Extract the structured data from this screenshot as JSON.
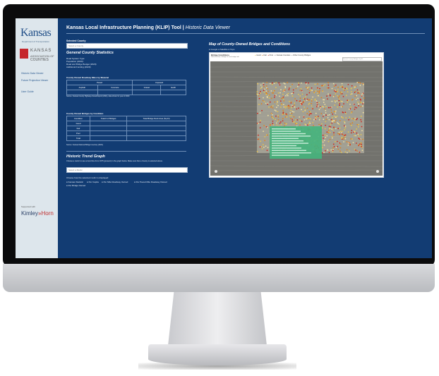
{
  "app": {
    "title": "Kansas Local Infrastructure Planning (KLIP) Tool |",
    "subtitle": "Historic Data Viewer"
  },
  "sidebar": {
    "logo_kansas": "Kansas",
    "logo_kdot": "Department of Transportation",
    "logo_counties_line1": "KANSAS",
    "logo_counties_line2": "ASSOCIATION OF",
    "logo_counties_line3": "COUNTIES",
    "links": [
      "Historic Data Viewer",
      "Future Projection Viewer",
      "User Guide"
    ],
    "supported_by": "Supported with",
    "partner_a": "Kimley",
    "partner_b": "»Horn"
  },
  "county": {
    "select_label": "Selected County",
    "select_placeholder": "Select a County",
    "stats_heading": "General County Statistics",
    "stats_lines": [
      "Road System Type:",
      "Population (2020):",
      "Road and Bridge Budget (2020):",
      "Additional Funding (2020):"
    ]
  },
  "roadway_table": {
    "title": "County Owned Roadway Miles by Material",
    "groups": [
      "Paved",
      "Unpaved"
    ],
    "columns": [
      "Asphalt",
      "Concrete",
      "Gravel",
      "Earth"
    ],
    "source": "Source: Kansas County Highway Annual Report (2021), data shown for year of 2020"
  },
  "bridge_table": {
    "title": "County Owned Bridges by Condition",
    "columns": [
      "Condition",
      "Total # of Bridges",
      "Total Bridge Deck Area (Sq Ft)"
    ],
    "rows": [
      "Good",
      "Fair",
      "Poor",
      "Total"
    ],
    "source": "Source: Kansas National Bridge Inventory (2021)"
  },
  "trend": {
    "heading": "Historic Trend Graph",
    "instructions": "Choose a metric to see a trend line from 1975 (present) in the graph below. Make sure that a County is selected above.",
    "select_placeholder": "Select a Metric",
    "choose_label": "Choose how the selected metric is displayed:",
    "options": [
      "Kansas Statistic",
      "Per Capita",
      "Per Mile Roadway Owned",
      "Per Paved Mile Roadway Owned",
      "Per Bridge Owned"
    ]
  },
  "map": {
    "title": "Map of County-Owned Bridges and Conditions",
    "basemap_options": [
      "Google",
      "Satellite",
      "Topo"
    ],
    "panel_title": "Bridge Conditions",
    "panel_sub": "Select (Click) a Bridge to view bridge info",
    "legend": [
      "Good",
      "Fair",
      "Poor",
      "Kansas Counties",
      "Other County Bridges"
    ],
    "search_placeholder": "Search County Bridges by ID"
  },
  "colors": {
    "screen_bg": "#123c73",
    "sidebar_bg": "#dde6ec",
    "good": "#e8c44a",
    "fair": "#e0821e",
    "poor": "#d0261c",
    "popup": "#45b37d"
  }
}
